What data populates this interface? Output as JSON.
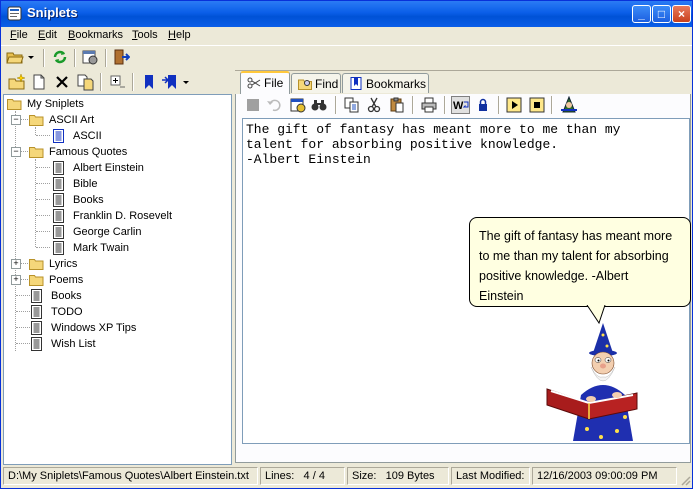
{
  "window": {
    "title": "Sniplets",
    "controls": [
      "_",
      "□",
      "×"
    ]
  },
  "menubar": [
    {
      "label": "File",
      "underline": "F",
      "rest": "ile"
    },
    {
      "label": "Edit",
      "underline": "E",
      "rest": "dit"
    },
    {
      "label": "Bookmarks",
      "underline": "B",
      "rest": "ookmarks"
    },
    {
      "label": "Tools",
      "underline": "T",
      "rest": "ools"
    },
    {
      "label": "Help",
      "underline": "H",
      "rest": "elp"
    }
  ],
  "tabs": [
    {
      "label": "File"
    },
    {
      "label": "Find"
    },
    {
      "label": "Bookmarks"
    }
  ],
  "tree": {
    "root": "My Sniplets",
    "ascii_art": "ASCII Art",
    "ascii": "ASCII",
    "famous_quotes": "Famous Quotes",
    "quotes": [
      "Albert Einstein",
      "Bible",
      "Books",
      "Franklin D. Rosevelt",
      "George Carlin",
      "Mark Twain"
    ],
    "lyrics": "Lyrics",
    "poems": "Poems",
    "files": [
      "Books",
      "TODO",
      "Windows XP Tips",
      "Wish List"
    ]
  },
  "editor": {
    "line1": "The gift of fantasy has meant more to me than my",
    "line2": "talent for absorbing positive knowledge.",
    "line3": "-Albert Einstein"
  },
  "balloon": {
    "line1": "The gift of fantasy has meant more",
    "line2": "to me than my talent for absorbing",
    "line3": "positive knowledge. -Albert",
    "line4": "Einstein"
  },
  "status": {
    "path": "D:\\My Sniplets\\Famous Quotes\\Albert Einstein.txt",
    "lines_label": "Lines:",
    "lines_value": "4 / 4",
    "size_label": "Size:",
    "size_value": "109 Bytes",
    "modified_label": "Last Modified:",
    "modified_value": "12/16/2003 09:00:09 PM"
  },
  "colors": {
    "titlebar": "#0a5ee8",
    "balloon": "#ffffe1",
    "folder": "#f5d77a"
  }
}
